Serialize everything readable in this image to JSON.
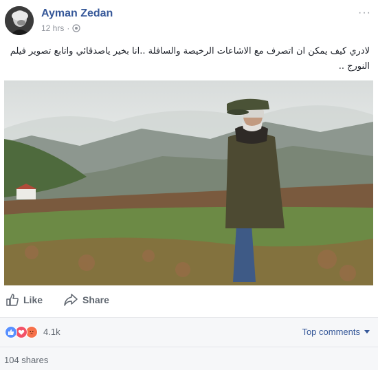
{
  "post": {
    "author": "Ayman Zedan",
    "time": "12 hrs",
    "separator": "·",
    "text": "لادري كيف يمكن ان اتصرف مع الاشاعات الرخيصة والسافلة ..انا بخير ياصدقائي واتابع تصوير فيلم النورج ..",
    "more_glyph": "···"
  },
  "actions": {
    "like_label": "Like",
    "share_label": "Share"
  },
  "reactions": {
    "count": "4.1k",
    "types": [
      "like",
      "love",
      "angry"
    ]
  },
  "comments": {
    "filter_label": "Top comments"
  },
  "shares": {
    "label": "104 shares"
  },
  "colors": {
    "link": "#365899",
    "muted": "#90949c",
    "like_blue": "#5890ff",
    "love_red": "#f25268",
    "angry_orange": "#f7714b"
  },
  "icons": {
    "privacy": "globe-icon",
    "like": "thumbs-up-icon",
    "share": "share-arrow-icon",
    "more": "ellipsis-icon"
  }
}
